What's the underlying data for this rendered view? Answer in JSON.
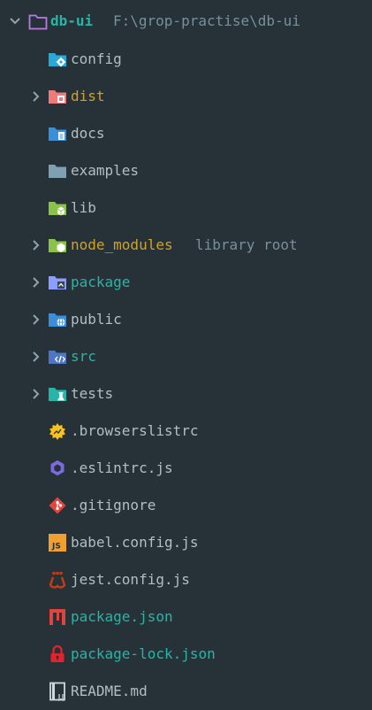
{
  "project": {
    "name": "db-ui",
    "path": "F:\\grop-practise\\db-ui",
    "expanded": true
  },
  "items": [
    {
      "label": "config",
      "kind": "folder",
      "icon": "config-folder-icon",
      "expandable": false,
      "color": "default"
    },
    {
      "label": "dist",
      "kind": "folder",
      "icon": "dist-folder-icon",
      "expandable": true,
      "color": "yellow"
    },
    {
      "label": "docs",
      "kind": "folder",
      "icon": "docs-folder-icon",
      "expandable": false,
      "color": "default"
    },
    {
      "label": "examples",
      "kind": "folder",
      "icon": "folder-icon",
      "expandable": false,
      "color": "default"
    },
    {
      "label": "lib",
      "kind": "folder",
      "icon": "lib-folder-icon",
      "expandable": false,
      "color": "default"
    },
    {
      "label": "node_modules",
      "kind": "folder",
      "icon": "node-modules-folder-icon",
      "expandable": true,
      "color": "yellow",
      "extra": "library root"
    },
    {
      "label": "package",
      "kind": "folder",
      "icon": "package-folder-icon",
      "expandable": true,
      "color": "teal"
    },
    {
      "label": "public",
      "kind": "folder",
      "icon": "public-folder-icon",
      "expandable": true,
      "color": "default"
    },
    {
      "label": "src",
      "kind": "folder",
      "icon": "src-folder-icon",
      "expandable": true,
      "color": "teal"
    },
    {
      "label": "tests",
      "kind": "folder",
      "icon": "tests-folder-icon",
      "expandable": true,
      "color": "default"
    },
    {
      "label": ".browserslistrc",
      "kind": "file",
      "icon": "browserslist-icon",
      "expandable": false,
      "color": "default"
    },
    {
      "label": ".eslintrc.js",
      "kind": "file",
      "icon": "eslint-icon",
      "expandable": false,
      "color": "default"
    },
    {
      "label": ".gitignore",
      "kind": "file",
      "icon": "git-icon",
      "expandable": false,
      "color": "default"
    },
    {
      "label": "babel.config.js",
      "kind": "file",
      "icon": "javascript-icon",
      "expandable": false,
      "color": "default"
    },
    {
      "label": "jest.config.js",
      "kind": "file",
      "icon": "jest-icon",
      "expandable": false,
      "color": "default"
    },
    {
      "label": "package.json",
      "kind": "file",
      "icon": "npm-icon",
      "expandable": false,
      "color": "teal"
    },
    {
      "label": "package-lock.json",
      "kind": "file",
      "icon": "lock-icon",
      "expandable": false,
      "color": "teal"
    },
    {
      "label": "README.md",
      "kind": "file",
      "icon": "readme-icon",
      "expandable": false,
      "color": "default"
    }
  ],
  "colors": {
    "background": "#263238",
    "text_default": "#b0bec5",
    "text_teal": "#26b5a6",
    "text_yellow": "#d3a220",
    "text_muted": "#78909c",
    "arrow": "#90a4ae"
  }
}
